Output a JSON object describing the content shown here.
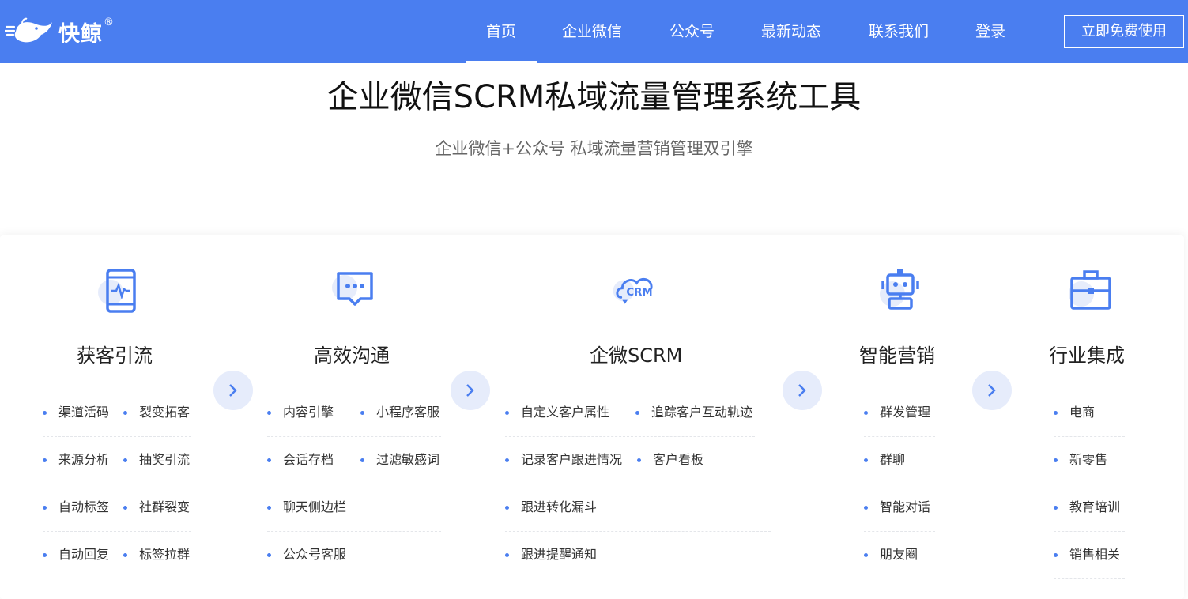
{
  "brand": {
    "name": "快鲸",
    "reg": "®"
  },
  "nav": {
    "items": [
      {
        "label": "首页",
        "active": true
      },
      {
        "label": "企业微信"
      },
      {
        "label": "公众号"
      },
      {
        "label": "最新动态"
      },
      {
        "label": "联系我们"
      },
      {
        "label": "登录"
      }
    ],
    "cta": "立即免费使用"
  },
  "hero": {
    "title": "企业微信SCRM私域流量管理系统工具",
    "subtitle": "企业微信+公众号 私域流量营销管理双引擎"
  },
  "columns": [
    {
      "title": "获客引流",
      "icon": "phone-heartbeat-icon",
      "items": [
        [
          "渠道活码",
          "裂变拓客"
        ],
        [
          "来源分析",
          "抽奖引流"
        ],
        [
          "自动标签",
          "社群裂变"
        ],
        [
          "自动回复",
          "标签拉群"
        ]
      ]
    },
    {
      "title": "高效沟通",
      "icon": "chat-bubble-icon",
      "items": [
        [
          "内容引擎",
          "小程序客服"
        ],
        [
          "会话存档",
          "过滤敏感词"
        ],
        [
          "聊天侧边栏"
        ],
        [
          "公众号客服"
        ]
      ]
    },
    {
      "title": "企微SCRM",
      "icon": "crm-cloud-icon",
      "items": [
        [
          "自定义客户属性",
          "追踪客户互动轨迹"
        ],
        [
          "记录客户跟进情况",
          "客户看板"
        ],
        [
          "跟进转化漏斗"
        ],
        [
          "跟进提醒通知"
        ]
      ]
    },
    {
      "title": "智能营销",
      "icon": "robot-icon",
      "items": [
        [
          "群发管理"
        ],
        [
          "群聊"
        ],
        [
          "智能对话"
        ],
        [
          "朋友圈"
        ]
      ]
    },
    {
      "title": "行业集成",
      "icon": "toolbox-icon",
      "items": [
        [
          "电商"
        ],
        [
          "新零售"
        ],
        [
          "教育培训"
        ],
        [
          "销售相关"
        ]
      ]
    }
  ],
  "colors": {
    "brand_blue": "#4a7ef0",
    "arrow_bg": "#e6ecfb"
  }
}
